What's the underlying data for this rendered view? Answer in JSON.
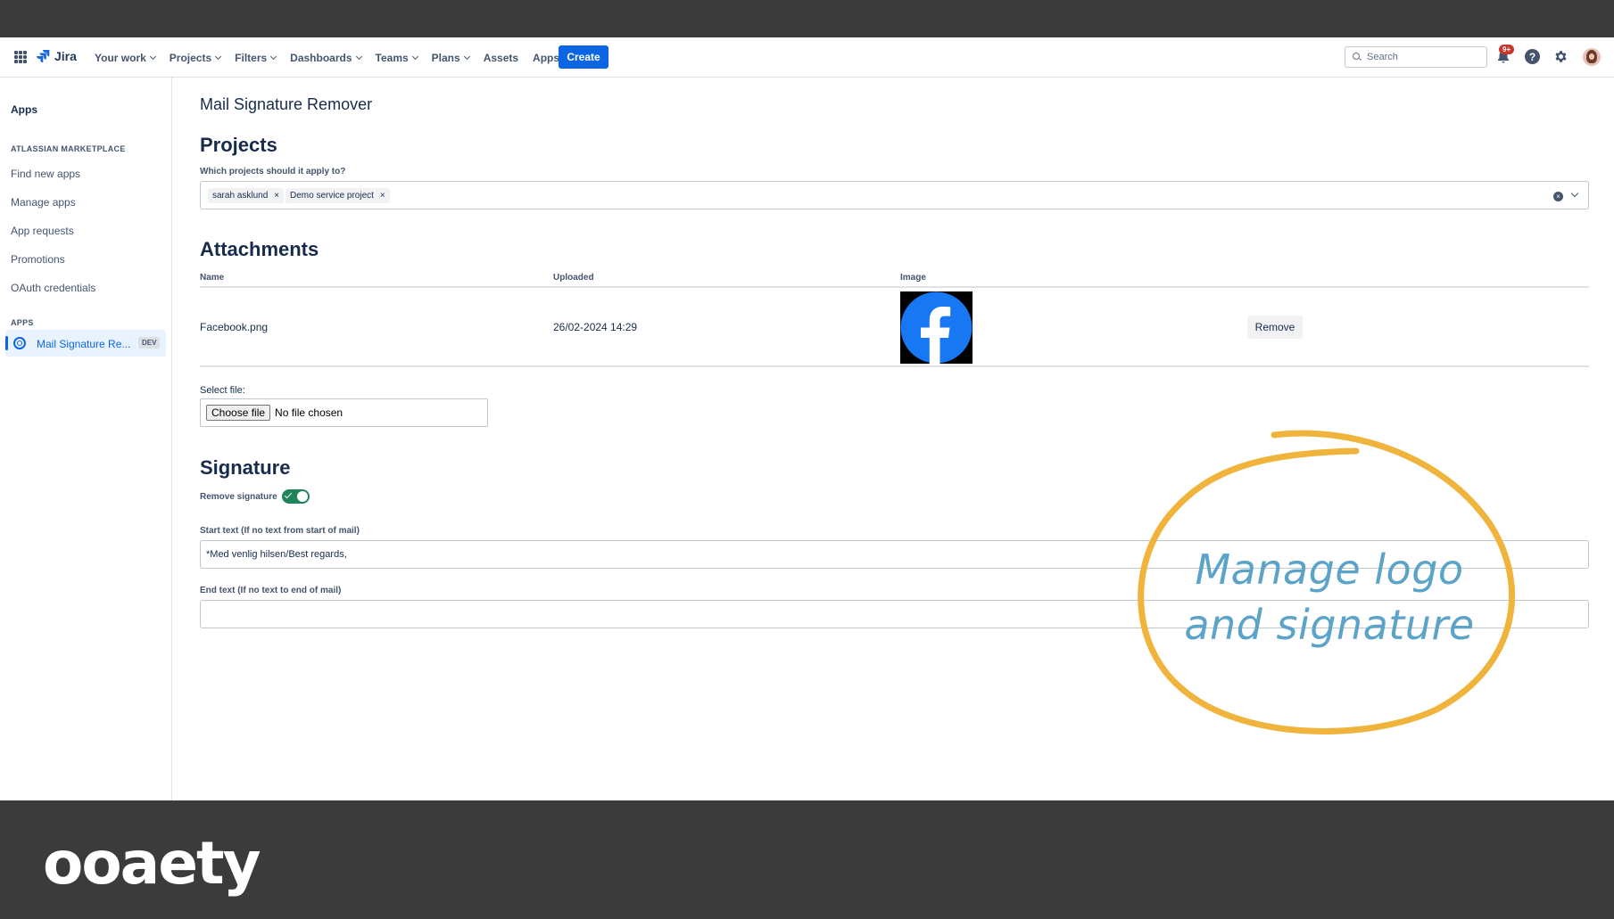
{
  "nav": {
    "product": "Jira",
    "menu": [
      {
        "label": "Your work",
        "dropdown": true
      },
      {
        "label": "Projects",
        "dropdown": true
      },
      {
        "label": "Filters",
        "dropdown": true
      },
      {
        "label": "Dashboards",
        "dropdown": true
      },
      {
        "label": "Teams",
        "dropdown": true
      },
      {
        "label": "Plans",
        "dropdown": true
      },
      {
        "label": "Assets",
        "dropdown": false
      },
      {
        "label": "Apps",
        "dropdown": true
      }
    ],
    "create_label": "Create",
    "search_placeholder": "Search",
    "notification_badge": "9+",
    "help_symbol": "?",
    "accent_color": "#0c66e4"
  },
  "sidebar": {
    "title": "Apps",
    "marketplace_section": "ATLASSIAN MARKETPLACE",
    "marketplace_items": [
      "Find new apps",
      "Manage apps",
      "App requests",
      "Promotions",
      "OAuth credentials"
    ],
    "apps_section": "APPS",
    "active_app": {
      "label": "Mail Signature Re...",
      "badge": "DEV"
    }
  },
  "main": {
    "page_title": "Mail Signature Remover",
    "projects": {
      "heading": "Projects",
      "label": "Which projects should it apply to?",
      "selected": [
        "sarah asklund",
        "Demo service project"
      ],
      "remove_symbol": "×",
      "clear_symbol": "×"
    },
    "attachments": {
      "heading": "Attachments",
      "columns": [
        "Name",
        "Uploaded",
        "Image"
      ],
      "rows": [
        {
          "name": "Facebook.png",
          "uploaded": "26/02-2024 14:29",
          "image": "facebook-logo",
          "action": "Remove"
        }
      ],
      "select_file_label": "Select file:",
      "choose_file": "Choose file",
      "no_file": "No file chosen"
    },
    "signature": {
      "heading": "Signature",
      "toggle_label": "Remove signature",
      "toggle_on": true,
      "start_label": "Start text (If no text from start of mail)",
      "start_value": "*Med venlig hilsen/Best regards,",
      "end_label": "End text (If no text to end of mail)",
      "end_value": ""
    }
  },
  "annotation": {
    "line1": "Manage logo",
    "line2": "and signature",
    "circle_color": "#f0b43c",
    "text_color": "#5ba3c9"
  },
  "brand": {
    "name": "ooaety"
  }
}
